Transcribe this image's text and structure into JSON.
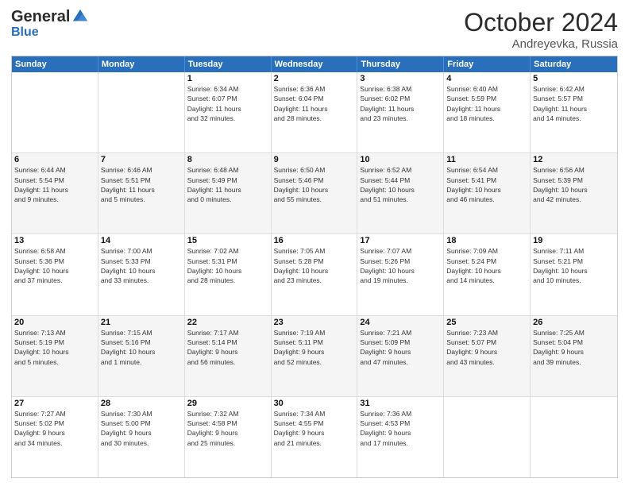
{
  "logo": {
    "general": "General",
    "blue": "Blue"
  },
  "title": {
    "month": "October 2024",
    "location": "Andreyevka, Russia"
  },
  "weekdays": [
    "Sunday",
    "Monday",
    "Tuesday",
    "Wednesday",
    "Thursday",
    "Friday",
    "Saturday"
  ],
  "weeks": [
    [
      {
        "day": "",
        "info": ""
      },
      {
        "day": "",
        "info": ""
      },
      {
        "day": "1",
        "info": "Sunrise: 6:34 AM\nSunset: 6:07 PM\nDaylight: 11 hours\nand 32 minutes."
      },
      {
        "day": "2",
        "info": "Sunrise: 6:36 AM\nSunset: 6:04 PM\nDaylight: 11 hours\nand 28 minutes."
      },
      {
        "day": "3",
        "info": "Sunrise: 6:38 AM\nSunset: 6:02 PM\nDaylight: 11 hours\nand 23 minutes."
      },
      {
        "day": "4",
        "info": "Sunrise: 6:40 AM\nSunset: 5:59 PM\nDaylight: 11 hours\nand 18 minutes."
      },
      {
        "day": "5",
        "info": "Sunrise: 6:42 AM\nSunset: 5:57 PM\nDaylight: 11 hours\nand 14 minutes."
      }
    ],
    [
      {
        "day": "6",
        "info": "Sunrise: 6:44 AM\nSunset: 5:54 PM\nDaylight: 11 hours\nand 9 minutes."
      },
      {
        "day": "7",
        "info": "Sunrise: 6:46 AM\nSunset: 5:51 PM\nDaylight: 11 hours\nand 5 minutes."
      },
      {
        "day": "8",
        "info": "Sunrise: 6:48 AM\nSunset: 5:49 PM\nDaylight: 11 hours\nand 0 minutes."
      },
      {
        "day": "9",
        "info": "Sunrise: 6:50 AM\nSunset: 5:46 PM\nDaylight: 10 hours\nand 55 minutes."
      },
      {
        "day": "10",
        "info": "Sunrise: 6:52 AM\nSunset: 5:44 PM\nDaylight: 10 hours\nand 51 minutes."
      },
      {
        "day": "11",
        "info": "Sunrise: 6:54 AM\nSunset: 5:41 PM\nDaylight: 10 hours\nand 46 minutes."
      },
      {
        "day": "12",
        "info": "Sunrise: 6:56 AM\nSunset: 5:39 PM\nDaylight: 10 hours\nand 42 minutes."
      }
    ],
    [
      {
        "day": "13",
        "info": "Sunrise: 6:58 AM\nSunset: 5:36 PM\nDaylight: 10 hours\nand 37 minutes."
      },
      {
        "day": "14",
        "info": "Sunrise: 7:00 AM\nSunset: 5:33 PM\nDaylight: 10 hours\nand 33 minutes."
      },
      {
        "day": "15",
        "info": "Sunrise: 7:02 AM\nSunset: 5:31 PM\nDaylight: 10 hours\nand 28 minutes."
      },
      {
        "day": "16",
        "info": "Sunrise: 7:05 AM\nSunset: 5:28 PM\nDaylight: 10 hours\nand 23 minutes."
      },
      {
        "day": "17",
        "info": "Sunrise: 7:07 AM\nSunset: 5:26 PM\nDaylight: 10 hours\nand 19 minutes."
      },
      {
        "day": "18",
        "info": "Sunrise: 7:09 AM\nSunset: 5:24 PM\nDaylight: 10 hours\nand 14 minutes."
      },
      {
        "day": "19",
        "info": "Sunrise: 7:11 AM\nSunset: 5:21 PM\nDaylight: 10 hours\nand 10 minutes."
      }
    ],
    [
      {
        "day": "20",
        "info": "Sunrise: 7:13 AM\nSunset: 5:19 PM\nDaylight: 10 hours\nand 5 minutes."
      },
      {
        "day": "21",
        "info": "Sunrise: 7:15 AM\nSunset: 5:16 PM\nDaylight: 10 hours\nand 1 minute."
      },
      {
        "day": "22",
        "info": "Sunrise: 7:17 AM\nSunset: 5:14 PM\nDaylight: 9 hours\nand 56 minutes."
      },
      {
        "day": "23",
        "info": "Sunrise: 7:19 AM\nSunset: 5:11 PM\nDaylight: 9 hours\nand 52 minutes."
      },
      {
        "day": "24",
        "info": "Sunrise: 7:21 AM\nSunset: 5:09 PM\nDaylight: 9 hours\nand 47 minutes."
      },
      {
        "day": "25",
        "info": "Sunrise: 7:23 AM\nSunset: 5:07 PM\nDaylight: 9 hours\nand 43 minutes."
      },
      {
        "day": "26",
        "info": "Sunrise: 7:25 AM\nSunset: 5:04 PM\nDaylight: 9 hours\nand 39 minutes."
      }
    ],
    [
      {
        "day": "27",
        "info": "Sunrise: 7:27 AM\nSunset: 5:02 PM\nDaylight: 9 hours\nand 34 minutes."
      },
      {
        "day": "28",
        "info": "Sunrise: 7:30 AM\nSunset: 5:00 PM\nDaylight: 9 hours\nand 30 minutes."
      },
      {
        "day": "29",
        "info": "Sunrise: 7:32 AM\nSunset: 4:58 PM\nDaylight: 9 hours\nand 25 minutes."
      },
      {
        "day": "30",
        "info": "Sunrise: 7:34 AM\nSunset: 4:55 PM\nDaylight: 9 hours\nand 21 minutes."
      },
      {
        "day": "31",
        "info": "Sunrise: 7:36 AM\nSunset: 4:53 PM\nDaylight: 9 hours\nand 17 minutes."
      },
      {
        "day": "",
        "info": ""
      },
      {
        "day": "",
        "info": ""
      }
    ]
  ]
}
